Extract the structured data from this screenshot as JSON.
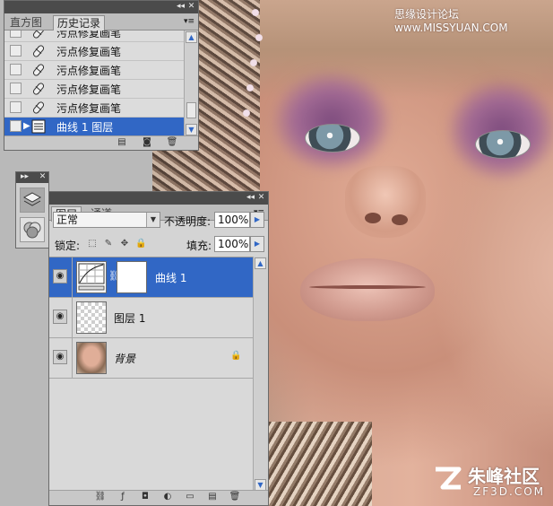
{
  "watermark_top": "思缘设计论坛 www.MISSYUAN.COM",
  "watermark_bottom": {
    "brand": "朱峰社区",
    "site": "ZF3D.COM"
  },
  "history_panel": {
    "tabs": [
      "直方图",
      "历史记录"
    ],
    "active_tab": "历史记录",
    "items": [
      {
        "label": "污点修复画笔",
        "selected": false,
        "icon": "healing-brush-icon"
      },
      {
        "label": "污点修复画笔",
        "selected": false,
        "icon": "healing-brush-icon"
      },
      {
        "label": "污点修复画笔",
        "selected": false,
        "icon": "healing-brush-icon"
      },
      {
        "label": "污点修复画笔",
        "selected": false,
        "icon": "healing-brush-icon"
      },
      {
        "label": "污点修复画笔",
        "selected": false,
        "icon": "healing-brush-icon"
      },
      {
        "label": "曲线 1 图层",
        "selected": true,
        "icon": "curves-layer-icon"
      }
    ],
    "footer_icons": [
      "new-document-from-state-icon",
      "camera-snapshot-icon",
      "trash-icon"
    ]
  },
  "layers_panel": {
    "tabs": [
      "图层",
      "通道"
    ],
    "active_tab": "图层",
    "blend_mode": "正常",
    "opacity_label": "不透明度:",
    "opacity_value": "100%",
    "lock_label": "锁定:",
    "fill_label": "填充:",
    "fill_value": "100%",
    "layers": [
      {
        "name": "曲线 1",
        "selected": true,
        "type": "curves-adjustment"
      },
      {
        "name": "图层 1",
        "selected": false,
        "type": "transparent"
      },
      {
        "name": "背景",
        "selected": false,
        "type": "photo",
        "locked": true
      }
    ]
  },
  "colors": {
    "selection": "#3167c5",
    "panel_bg": "#d4d4d4",
    "titlebar": "#4b4b4b"
  }
}
